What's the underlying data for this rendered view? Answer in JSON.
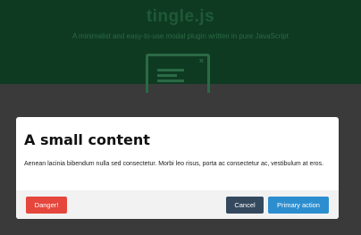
{
  "background": {
    "title": "tingle.js",
    "subtitle": "A minimalist and easy-to-use modal plugin written in pure JavaScript",
    "logo_icon": "modal-window-icon"
  },
  "modal": {
    "title": "A small content",
    "body": "Aenean lacinia bibendum nulla sed consectetur. Morbi leo risus, porta ac consectetur ac, vestibulum at eros.",
    "buttons": {
      "danger": "Danger!",
      "cancel": "Cancel",
      "primary": "Primary action"
    }
  },
  "colors": {
    "danger": "#e5473c",
    "cancel": "#34495e",
    "primary": "#2c8ecf",
    "overlay": "#3a3a3a"
  }
}
